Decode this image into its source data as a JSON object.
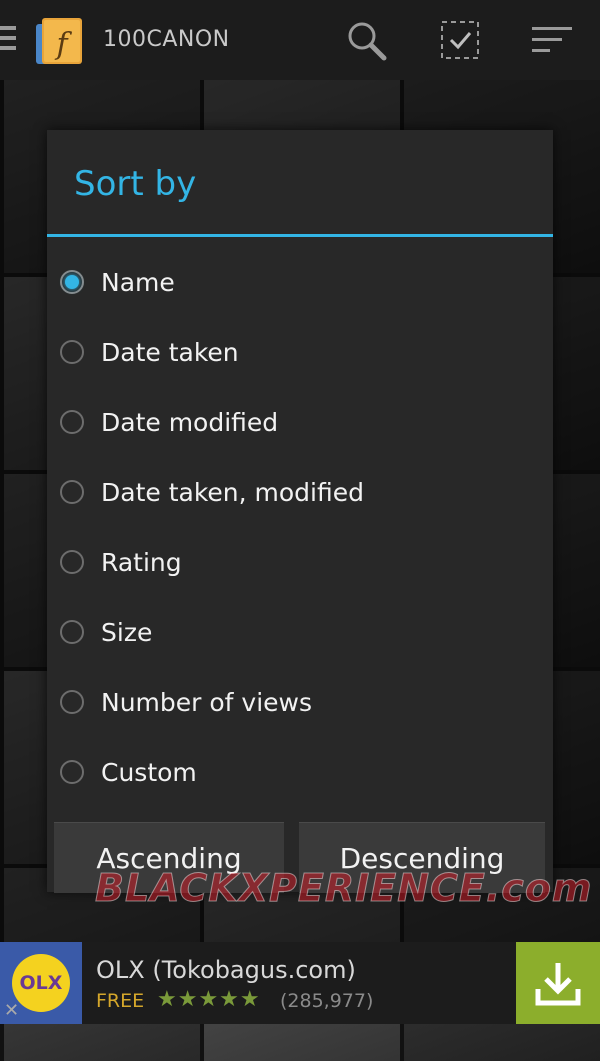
{
  "app_bar": {
    "title": "100CANON",
    "logo_letter": "f",
    "icons": [
      "menu-icon",
      "search-icon",
      "select-all-icon",
      "sort-icon"
    ]
  },
  "dialog": {
    "title": "Sort by",
    "accent_color": "#33b5e5",
    "options": [
      {
        "label": "Name",
        "selected": true
      },
      {
        "label": "Date taken",
        "selected": false
      },
      {
        "label": "Date modified",
        "selected": false
      },
      {
        "label": "Date taken, modified",
        "selected": false
      },
      {
        "label": "Rating",
        "selected": false
      },
      {
        "label": "Size",
        "selected": false
      },
      {
        "label": "Number of views",
        "selected": false
      },
      {
        "label": "Custom",
        "selected": false
      }
    ],
    "buttons": {
      "ascending": "Ascending",
      "descending": "Descending"
    }
  },
  "watermark": "BLACKXPERIENCE.com",
  "ad": {
    "logo_text": "OLX",
    "title": "OLX (Tokobagus.com)",
    "price": "FREE",
    "stars": "★★★★★",
    "rating_count": "(285,977)",
    "download_icon": "download-icon"
  }
}
